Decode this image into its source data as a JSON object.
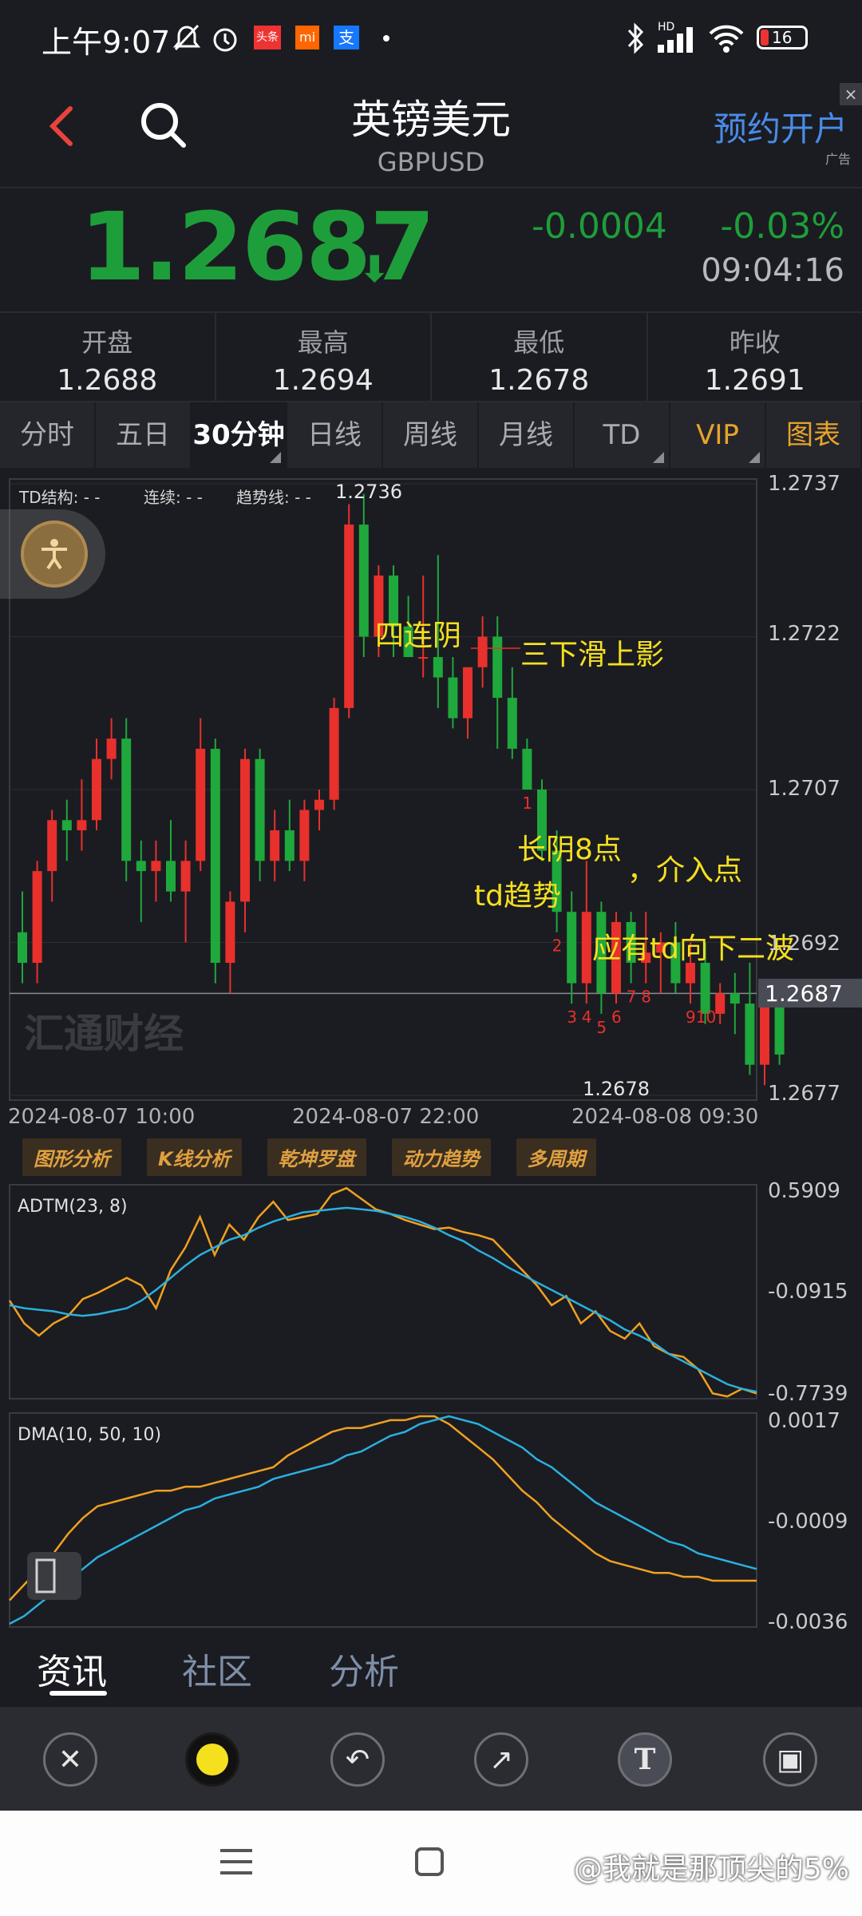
{
  "status_bar": {
    "time": "上午9:07",
    "battery": "16",
    "hd": "HD"
  },
  "header": {
    "title": "英镑美元",
    "symbol": "GBPUSD",
    "book_button": "预约开户",
    "ad_label": "广告"
  },
  "quote": {
    "price": "1.2687",
    "change": "-0.0004",
    "change_pct": "-0.03%",
    "time": "09:04:16",
    "color": "#1e9e3a"
  },
  "stats": [
    {
      "label": "开盘",
      "value": "1.2688"
    },
    {
      "label": "最高",
      "value": "1.2694"
    },
    {
      "label": "最低",
      "value": "1.2678"
    },
    {
      "label": "昨收",
      "value": "1.2691"
    }
  ],
  "period_tabs": [
    "分时",
    "五日",
    "30分钟",
    "日线",
    "周线",
    "月线",
    "TD",
    "VIP",
    "图表"
  ],
  "main_chart": {
    "td_labels": {
      "structure": "TD结构: - -",
      "continuous": "连续: - -",
      "trend": "趋势线: - -"
    },
    "high_marker": "1.2736",
    "low_marker": "1.2678",
    "y_ticks": [
      "1.2737",
      "1.2722",
      "1.2707",
      "1.2692",
      "1.2677"
    ],
    "current_price_tag": "1.2687",
    "x_ticks": [
      "2024-08-07 10:00",
      "2024-08-07 22:00",
      "2024-08-08 09:30"
    ],
    "watermark": "汇通财经",
    "annotations": [
      "四连阴",
      "三下滑上影",
      "长阴8点",
      "，介入点",
      "td趋势",
      "应有td向下二波"
    ],
    "td_counts": [
      "1",
      "2",
      "3",
      "4",
      "5",
      "6",
      "7",
      "8",
      "910"
    ]
  },
  "analysis_tools": [
    "图形分析",
    "K线分析",
    "乾坤罗盘",
    "动力趋势",
    "多周期"
  ],
  "adtm": {
    "title": "ADTM(23, 8)",
    "y_ticks": [
      "0.5909",
      "-0.0915",
      "-0.7739"
    ]
  },
  "dma": {
    "title": "DMA(10, 50, 10)",
    "y_ticks": [
      "0.0017",
      "-0.0009",
      "-0.0036"
    ]
  },
  "news_tabs": [
    "资讯",
    "社区",
    "分析"
  ],
  "watermark_user": "@我就是那顶尖的5%",
  "colors": {
    "up": "#e8302c",
    "down": "#1fa83c",
    "ma_orange": "#f0a020",
    "ma_blue": "#2ab0e0",
    "annotation": "#f5e020"
  },
  "chart_data": {
    "type": "candlestick",
    "title": "",
    "xlabel": "",
    "ylabel": "",
    "ylim": [
      1.2677,
      1.2737
    ],
    "candles": [
      [
        1.2693,
        1.2697,
        1.2688,
        1.269
      ],
      [
        1.269,
        1.27,
        1.2688,
        1.2699
      ],
      [
        1.2699,
        1.2705,
        1.2696,
        1.2704
      ],
      [
        1.2704,
        1.2706,
        1.27,
        1.2703
      ],
      [
        1.2703,
        1.2708,
        1.2701,
        1.2704
      ],
      [
        1.2704,
        1.2712,
        1.2703,
        1.271
      ],
      [
        1.271,
        1.2714,
        1.2708,
        1.2712
      ],
      [
        1.2712,
        1.2714,
        1.2698,
        1.27
      ],
      [
        1.27,
        1.2702,
        1.2694,
        1.2699
      ],
      [
        1.2699,
        1.2702,
        1.2696,
        1.27
      ],
      [
        1.27,
        1.2704,
        1.2696,
        1.2697
      ],
      [
        1.2697,
        1.2702,
        1.2692,
        1.27
      ],
      [
        1.27,
        1.2714,
        1.2699,
        1.2711
      ],
      [
        1.2711,
        1.2712,
        1.2688,
        1.269
      ],
      [
        1.269,
        1.2697,
        1.2687,
        1.2696
      ],
      [
        1.2696,
        1.2711,
        1.2693,
        1.271
      ],
      [
        1.271,
        1.2711,
        1.2698,
        1.27
      ],
      [
        1.27,
        1.2705,
        1.2698,
        1.2703
      ],
      [
        1.2703,
        1.2706,
        1.2699,
        1.27
      ],
      [
        1.27,
        1.2706,
        1.2698,
        1.2705
      ],
      [
        1.2705,
        1.2707,
        1.2703,
        1.2706
      ],
      [
        1.2706,
        1.2716,
        1.2705,
        1.2715
      ],
      [
        1.2715,
        1.2735,
        1.2714,
        1.2733
      ],
      [
        1.2733,
        1.2736,
        1.272,
        1.2722
      ],
      [
        1.2722,
        1.2729,
        1.272,
        1.2728
      ],
      [
        1.2728,
        1.2729,
        1.272,
        1.2723
      ],
      [
        1.2723,
        1.2726,
        1.272,
        1.272
      ],
      [
        1.272,
        1.2728,
        1.2718,
        1.272
      ],
      [
        1.272,
        1.273,
        1.2715,
        1.2718
      ],
      [
        1.2718,
        1.272,
        1.2713,
        1.2714
      ],
      [
        1.2714,
        1.2719,
        1.2712,
        1.2719
      ],
      [
        1.2719,
        1.2724,
        1.2717,
        1.2722
      ],
      [
        1.2722,
        1.2724,
        1.2711,
        1.2716
      ],
      [
        1.2716,
        1.2719,
        1.271,
        1.2711
      ],
      [
        1.2711,
        1.2712,
        1.2707,
        1.2707
      ],
      [
        1.2707,
        1.2708,
        1.27,
        1.2701
      ],
      [
        1.2701,
        1.2703,
        1.2693,
        1.2695
      ],
      [
        1.2695,
        1.2697,
        1.2686,
        1.2688
      ],
      [
        1.2688,
        1.27,
        1.2686,
        1.2695
      ],
      [
        1.2695,
        1.2696,
        1.2685,
        1.2687
      ],
      [
        1.2687,
        1.2695,
        1.2686,
        1.2694
      ],
      [
        1.2694,
        1.2695,
        1.2688,
        1.269
      ],
      [
        1.269,
        1.2695,
        1.2688,
        1.2691
      ],
      [
        1.2691,
        1.2693,
        1.2687,
        1.2692
      ],
      [
        1.2692,
        1.2694,
        1.2687,
        1.2688
      ],
      [
        1.2688,
        1.2692,
        1.2686,
        1.269
      ],
      [
        1.269,
        1.2692,
        1.2684,
        1.2685
      ],
      [
        1.2685,
        1.2688,
        1.2684,
        1.2687
      ],
      [
        1.2687,
        1.2689,
        1.2683,
        1.2686
      ],
      [
        1.2686,
        1.269,
        1.2679,
        1.268
      ],
      [
        1.268,
        1.2688,
        1.2678,
        1.2687
      ],
      [
        1.2687,
        1.2688,
        1.268,
        1.2681
      ]
    ],
    "adtm": [
      -0.15,
      -0.3,
      -0.38,
      -0.3,
      -0.25,
      -0.14,
      -0.1,
      -0.05,
      0.0,
      -0.05,
      -0.2,
      0.05,
      0.2,
      0.4,
      0.15,
      0.35,
      0.25,
      0.4,
      0.5,
      0.38,
      0.4,
      0.42,
      0.55,
      0.59,
      0.52,
      0.45,
      0.42,
      0.38,
      0.35,
      0.32,
      0.33,
      0.3,
      0.28,
      0.25,
      0.15,
      0.05,
      -0.05,
      -0.18,
      -0.12,
      -0.3,
      -0.22,
      -0.35,
      -0.4,
      -0.3,
      -0.45,
      -0.5,
      -0.52,
      -0.6,
      -0.76,
      -0.78,
      -0.73,
      -0.76
    ],
    "adtm_ma": [
      -0.18,
      -0.2,
      -0.21,
      -0.22,
      -0.24,
      -0.25,
      -0.24,
      -0.22,
      -0.2,
      -0.15,
      -0.08,
      0.0,
      0.08,
      0.15,
      0.2,
      0.25,
      0.28,
      0.33,
      0.37,
      0.4,
      0.43,
      0.44,
      0.45,
      0.46,
      0.45,
      0.44,
      0.42,
      0.4,
      0.37,
      0.33,
      0.28,
      0.24,
      0.18,
      0.13,
      0.07,
      0.02,
      -0.03,
      -0.08,
      -0.13,
      -0.18,
      -0.23,
      -0.28,
      -0.34,
      -0.38,
      -0.43,
      -0.5,
      -0.55,
      -0.6,
      -0.65,
      -0.7,
      -0.73,
      -0.75
    ],
    "dma": [
      -0.003,
      -0.0026,
      -0.0022,
      -0.0018,
      -0.0013,
      -0.0009,
      -0.0006,
      -0.0005,
      -0.0004,
      -0.0003,
      -0.0002,
      -0.0002,
      -0.0001,
      -0.0001,
      0.0,
      0.0001,
      0.0002,
      0.0003,
      0.0004,
      0.0007,
      0.0009,
      0.0011,
      0.0013,
      0.0014,
      0.0014,
      0.0015,
      0.0016,
      0.0016,
      0.0017,
      0.0017,
      0.0015,
      0.0012,
      0.0009,
      0.0006,
      0.0002,
      -0.0002,
      -0.0005,
      -0.0009,
      -0.0012,
      -0.0015,
      -0.0018,
      -0.002,
      -0.0021,
      -0.0022,
      -0.0023,
      -0.0023,
      -0.0024,
      -0.0024,
      -0.0025,
      -0.0025,
      -0.0025,
      -0.0025
    ],
    "dma_ama": [
      -0.0036,
      -0.0034,
      -0.0031,
      -0.0028,
      -0.0025,
      -0.0022,
      -0.0019,
      -0.0017,
      -0.0015,
      -0.0013,
      -0.0011,
      -0.0009,
      -0.0007,
      -0.0006,
      -0.0004,
      -0.0003,
      -0.0002,
      -0.0001,
      0.0001,
      0.0002,
      0.0003,
      0.0004,
      0.0005,
      0.0007,
      0.0008,
      0.001,
      0.0012,
      0.0013,
      0.0015,
      0.0016,
      0.0017,
      0.0016,
      0.0015,
      0.0013,
      0.0011,
      0.0009,
      0.0006,
      0.0004,
      0.0001,
      -0.0002,
      -0.0005,
      -0.0007,
      -0.0009,
      -0.0011,
      -0.0013,
      -0.0015,
      -0.0016,
      -0.0018,
      -0.0019,
      -0.002,
      -0.0021,
      -0.0022
    ]
  }
}
